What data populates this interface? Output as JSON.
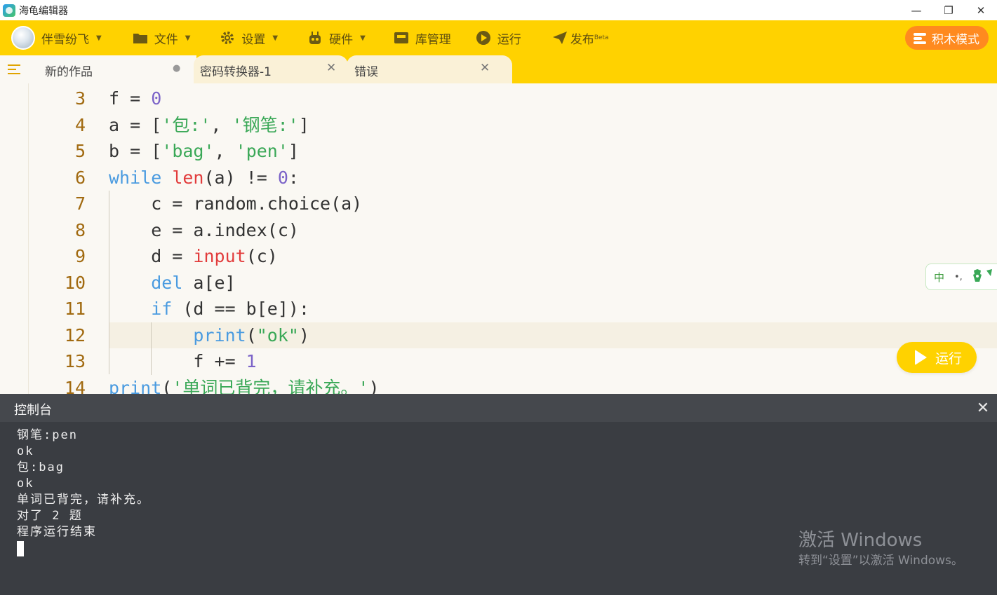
{
  "window": {
    "title": "海龟编辑器",
    "controls": {
      "minimize": "—",
      "maximize": "❐",
      "close": "✕"
    }
  },
  "toolbar": {
    "user_name": "伴雪纷飞",
    "file": "文件",
    "settings": "设置",
    "hardware": "硬件",
    "library": "库管理",
    "run": "运行",
    "publish": "发布",
    "publish_badge": "Beta",
    "block_mode": "积木模式",
    "accent_color": "#ffd200",
    "block_mode_color": "#ff8a1f"
  },
  "tabs": [
    {
      "label": "新的作品",
      "close": "●"
    },
    {
      "label": "密码转换器-1",
      "close": "✕"
    },
    {
      "label": "错误",
      "close": "✕"
    }
  ],
  "editor": {
    "lines": [
      {
        "no": "3",
        "tokens": [
          {
            "t": "f = ",
            "c": "plain"
          },
          {
            "t": "0",
            "c": "num"
          }
        ]
      },
      {
        "no": "4",
        "tokens": [
          {
            "t": "a = [",
            "c": "plain"
          },
          {
            "t": "'包:'",
            "c": "str"
          },
          {
            "t": ", ",
            "c": "plain"
          },
          {
            "t": "'钢笔:'",
            "c": "str"
          },
          {
            "t": "]",
            "c": "plain"
          }
        ]
      },
      {
        "no": "5",
        "tokens": [
          {
            "t": "b = [",
            "c": "plain"
          },
          {
            "t": "'bag'",
            "c": "str"
          },
          {
            "t": ", ",
            "c": "plain"
          },
          {
            "t": "'pen'",
            "c": "str"
          },
          {
            "t": "]",
            "c": "plain"
          }
        ]
      },
      {
        "no": "6",
        "tokens": [
          {
            "t": "while",
            "c": "kw"
          },
          {
            "t": " ",
            "c": "plain"
          },
          {
            "t": "len",
            "c": "fn"
          },
          {
            "t": "(a) != ",
            "c": "plain"
          },
          {
            "t": "0",
            "c": "num"
          },
          {
            "t": ":",
            "c": "plain"
          }
        ]
      },
      {
        "no": "7",
        "tokens": [
          {
            "t": "    c = random.choice(a)",
            "c": "plain"
          }
        ]
      },
      {
        "no": "8",
        "tokens": [
          {
            "t": "    e = a.index(c)",
            "c": "plain"
          }
        ]
      },
      {
        "no": "9",
        "tokens": [
          {
            "t": "    d = ",
            "c": "plain"
          },
          {
            "t": "input",
            "c": "fn"
          },
          {
            "t": "(c)",
            "c": "plain"
          }
        ]
      },
      {
        "no": "10",
        "tokens": [
          {
            "t": "    ",
            "c": "plain"
          },
          {
            "t": "del",
            "c": "kw"
          },
          {
            "t": " a[e]",
            "c": "plain"
          }
        ]
      },
      {
        "no": "11",
        "tokens": [
          {
            "t": "    ",
            "c": "plain"
          },
          {
            "t": "if",
            "c": "kw"
          },
          {
            "t": " (d == b[e]):",
            "c": "plain"
          }
        ]
      },
      {
        "no": "12",
        "tokens": [
          {
            "t": "        ",
            "c": "plain"
          },
          {
            "t": "print",
            "c": "kw"
          },
          {
            "t": "(",
            "c": "plain"
          },
          {
            "t": "\"ok\"",
            "c": "str"
          },
          {
            "t": ")",
            "c": "plain"
          }
        ]
      },
      {
        "no": "13",
        "tokens": [
          {
            "t": "        f += ",
            "c": "plain"
          },
          {
            "t": "1",
            "c": "num"
          }
        ]
      },
      {
        "no": "14",
        "tokens": [
          {
            "t": "print",
            "c": "kw"
          },
          {
            "t": "(",
            "c": "plain"
          },
          {
            "t": "'单词已背完，请补充。'",
            "c": "str"
          },
          {
            "t": ")",
            "c": "plain"
          }
        ]
      }
    ],
    "ime_indicator": "中",
    "ime_punct": "•,",
    "run_button": "运行"
  },
  "console": {
    "title": "控制台",
    "close": "✕",
    "lines": [
      "钢笔:pen",
      "ok",
      "包:bag",
      "ok",
      "单词已背完，请补充。",
      "对了 2 题",
      "程序运行结束"
    ]
  },
  "watermark": {
    "line1": "激活 Windows",
    "line2": "转到“设置”以激活 Windows。"
  }
}
